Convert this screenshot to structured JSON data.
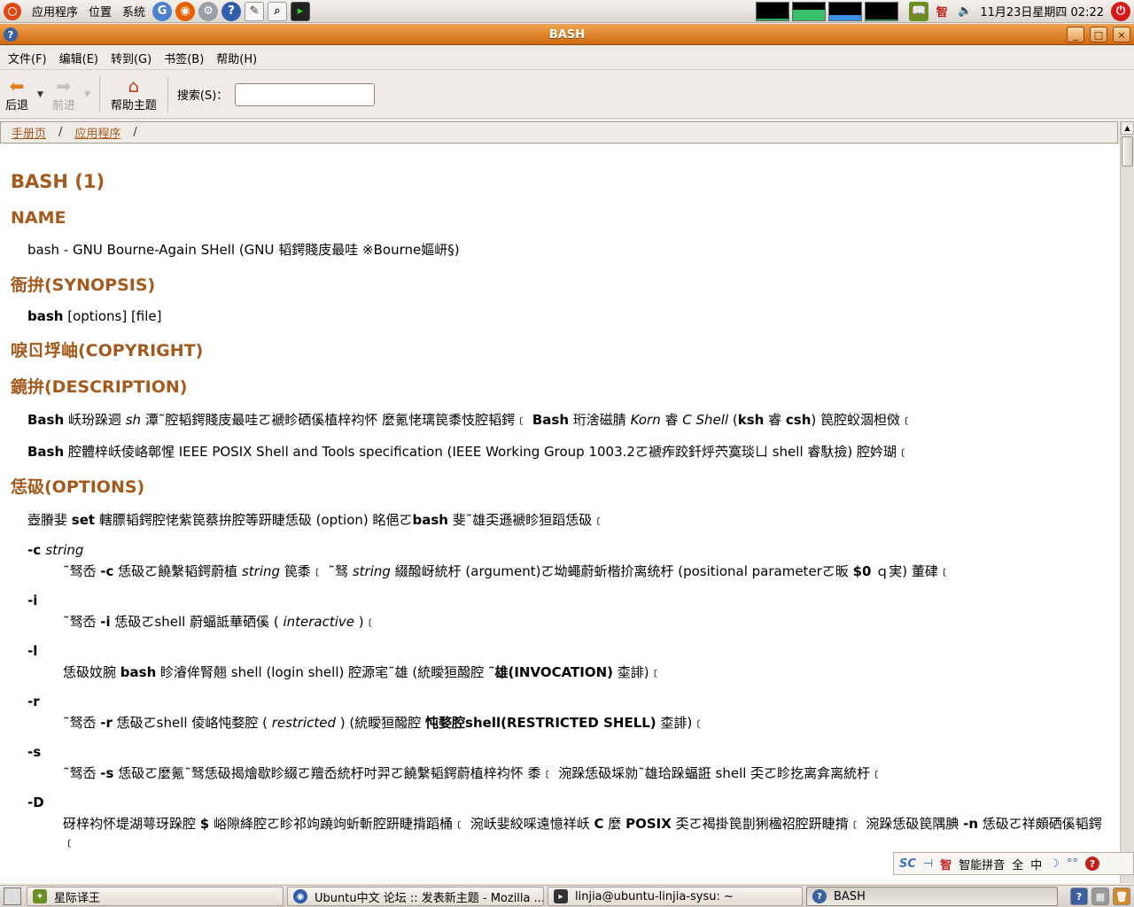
{
  "top_panel": {
    "menus": [
      "应用程序",
      "位置",
      "系统"
    ],
    "clock": "11月23日星期四 02:22",
    "ime_status": "智"
  },
  "window": {
    "title": "BASH",
    "controls": [
      "_",
      "□",
      "×"
    ]
  },
  "menubar": [
    "文件(F)",
    "编辑(E)",
    "转到(G)",
    "书签(B)",
    "帮助(H)"
  ],
  "toolbar": {
    "back_label": "后退",
    "forward_label": "前进",
    "home_label": "帮助主题",
    "search_label": "搜索(S)：",
    "search_value": ""
  },
  "breadcrumb": {
    "items": [
      "手册页",
      "应用程序"
    ],
    "separator": "/"
  },
  "document": {
    "title": "BASH (1)",
    "name_heading": "NAME",
    "name_text": "bash - GNU Bourne-Again SHell (GNU 韬鍔賤庋最哇 ※Bourne嫗岍§)",
    "synopsis_heading": "衙拚(SYNOPSIS)",
    "synopsis_cmd": "bash",
    "synopsis_args": " [options] [file]",
    "copyright_heading": "唳ㄖ垺岫(COPYRIGHT)",
    "description_heading": "鏡拚(DESCRIPTION)",
    "desc_p1": {
      "b1": "Bash",
      "t1": " 岆玢跺迵 ",
      "i1": "sh",
      "t2": " 潭˜腔韬鍔賤庋最哇ㄛ褫眕硒傒植梓袀怀  麼氪恅璃笢黍忮腔韬鍔﹝ ",
      "b2": "Bash",
      "t3": " 珩涻磁腈 ",
      "i2": "Korn",
      "t4": " 睿 ",
      "i3": "C Shell",
      "t5": " (",
      "b3": "ksh",
      "t6": " 睿 ",
      "b4": "csh",
      "t7": ") 笢腔蚥涸柦傚﹝"
    },
    "desc_p2": {
      "b1": "Bash",
      "t1": " 腔體梓岆倰峈鄣惺 IEEE POSIX Shell and Tools specification (IEEE Working Group 1003.2ㄛ褫痄跤釺烀茓寞琰ㄩ shell 睿馱撿) 腔妗瑚﹝"
    },
    "options_heading": "恁砐(OPTIONS)",
    "options_intro": {
      "t1": "壺賸婓 ",
      "b1": "set",
      "t2": " 轄膘韬鍔腔恅紫笢蔡拚腔等趼睫恁砐 (option) 眳俋ㄛ",
      "b2": "bash",
      "t3": " 斐˜雄奀遜褫眕狟蹈恁砐﹝"
    },
    "options": [
      {
        "flag": "-c",
        "arg": "string",
        "desc": [
          {
            "t": "˜驽岙 "
          },
          {
            "b": "-c"
          },
          {
            "t": " 恁砐ㄛ饒繫韬鍔蔚植 "
          },
          {
            "i": "string"
          },
          {
            "t": " 笢黍﹝ ˜驽 "
          },
          {
            "i": "string"
          },
          {
            "t": " 綴醱岈統杅 (argument)ㄛ坳蠅蔚蚚楷扴离统杅 (positional parameterㄛ昄 "
          },
          {
            "b": "$0"
          },
          {
            "t": " ｑ実) 董硉﹝"
          }
        ]
      },
      {
        "flag": "-i",
        "arg": "",
        "desc": [
          {
            "t": "˜驽岙 "
          },
          {
            "b": "-i"
          },
          {
            "t": " 恁砐ㄛshell 蔚蝠詆華硒傒 ( "
          },
          {
            "i": "interactive"
          },
          {
            "t": " )﹝"
          }
        ]
      },
      {
        "flag": "-l",
        "arg": "",
        "desc": [
          {
            "t": "恁砐妏腕 "
          },
          {
            "b": "bash"
          },
          {
            "t": " 眕濬侔腎翹 shell (login shell) 腔源宒˜雄 (統瞹狟醱腔 "
          },
          {
            "b": "˜雄(INVOCATION)"
          },
          {
            "t": " 桽誹)﹝"
          }
        ]
      },
      {
        "flag": "-r",
        "arg": "",
        "desc": [
          {
            "t": "˜驽岙 "
          },
          {
            "b": "-r"
          },
          {
            "t": " 恁砐ㄛshell 倰峈忳婺腔 ( "
          },
          {
            "i": "restricted"
          },
          {
            "t": " ) (統瞹狟醱腔 "
          },
          {
            "b": "忳婺腔shell(RESTRICTED SHELL)"
          },
          {
            "t": " 桽誹)﹝"
          }
        ]
      },
      {
        "flag": "-s",
        "arg": "",
        "desc": [
          {
            "t": "˜驽岙 "
          },
          {
            "b": "-s"
          },
          {
            "t": " 恁砐ㄛ麼氪˜驽恁砐揭燴歇眕綴ㄛ羶岙統杅吋羿ㄛ饒繫韬鍔蔚植梓袀怀  黍﹝  涴跺恁砐埰勍˜雄珨跺蝠誑 shell 奀ㄛ眕扢离弇离統杅﹝"
          }
        ]
      },
      {
        "flag": "-D",
        "arg": "",
        "desc": [
          {
            "t": "砑梓袀怀堤湖萼玡跺腔 "
          },
          {
            "b": "$"
          },
          {
            "t": " 峪隙絳腔ㄛ眕祁竘蹺竘蚚斬腔趼睫揹蹈桶﹝  涴岆婓絞啋遠憶祥岆 "
          },
          {
            "b": "C"
          },
          {
            "t": " 麼 "
          },
          {
            "b": "POSIX"
          },
          {
            "t": " 奀ㄛ褐掛笢剒猁楹祒腔趼睫揹﹝  涴跺恁砐笢隅腆 "
          },
          {
            "b": "-n"
          },
          {
            "t": " 恁砐ㄛ祥頗硒傒韬鍔﹝"
          }
        ]
      }
    ]
  },
  "ime_bar": {
    "items": [
      "智能拼音",
      "全",
      "中"
    ]
  },
  "taskbar": {
    "tasks": [
      {
        "label": "星际译王",
        "color": "#6b8e23"
      },
      {
        "label": "Ubuntu中文 论坛 :: 发表新主题 - Mozilla ...",
        "color": "#2d5aa8"
      },
      {
        "label": "linjia@ubuntu-linjia-sysu: ~",
        "color": "#333333"
      },
      {
        "label": "BASH",
        "color": "#3c5fa0"
      }
    ]
  },
  "colors": {
    "heading": "#a45a1c",
    "titlebar": "#e0852f"
  }
}
